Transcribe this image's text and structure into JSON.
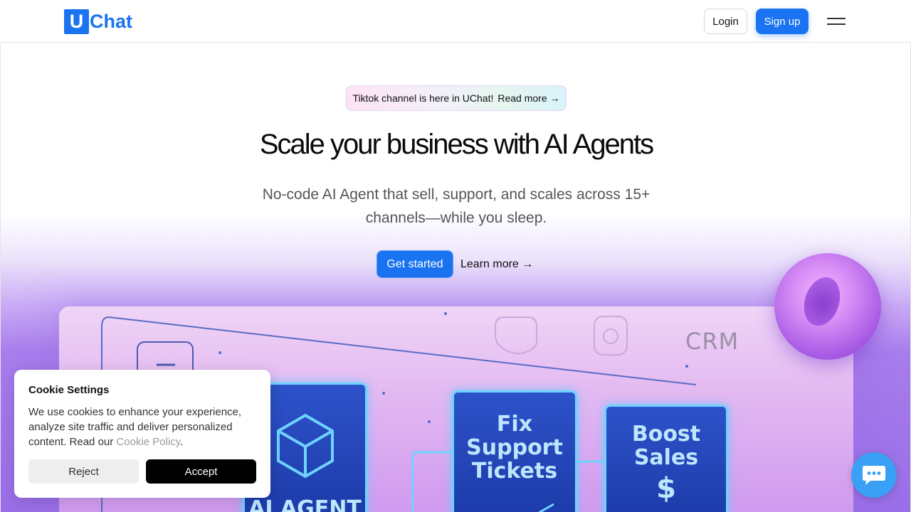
{
  "header": {
    "logo_letter": "U",
    "logo_text": "Chat",
    "login_label": "Login",
    "signup_label": "Sign up"
  },
  "hero": {
    "announcement_text": "Tiktok channel is here in UChat!",
    "announcement_link": "Read more →",
    "headline": "Scale your business with AI Agents",
    "subhead": "No-code AI Agent that sell, support, and scales across 15+ channels—while you sleep.",
    "cta_primary": "Get started",
    "cta_secondary": "Learn more →"
  },
  "illustration": {
    "crm_label": "CRM",
    "card_agent": "AI AGENT",
    "card_support": [
      "Fix",
      "Support",
      "Tickets"
    ],
    "card_sales": [
      "Boost",
      "Sales"
    ]
  },
  "cookie": {
    "title": "Cookie Settings",
    "body": "We use cookies to enhance your experience, analyze site traffic and deliver personalized content. Read our ",
    "link": "Cookie Policy",
    "period": ".",
    "reject_label": "Reject",
    "accept_label": "Accept"
  },
  "colors": {
    "brand": "#1a73f0",
    "chat": "#39a0f5"
  },
  "icons": {
    "menu": "hamburger-menu-icon",
    "chat": "chat-bubble-icon",
    "cube": "cube-icon"
  }
}
